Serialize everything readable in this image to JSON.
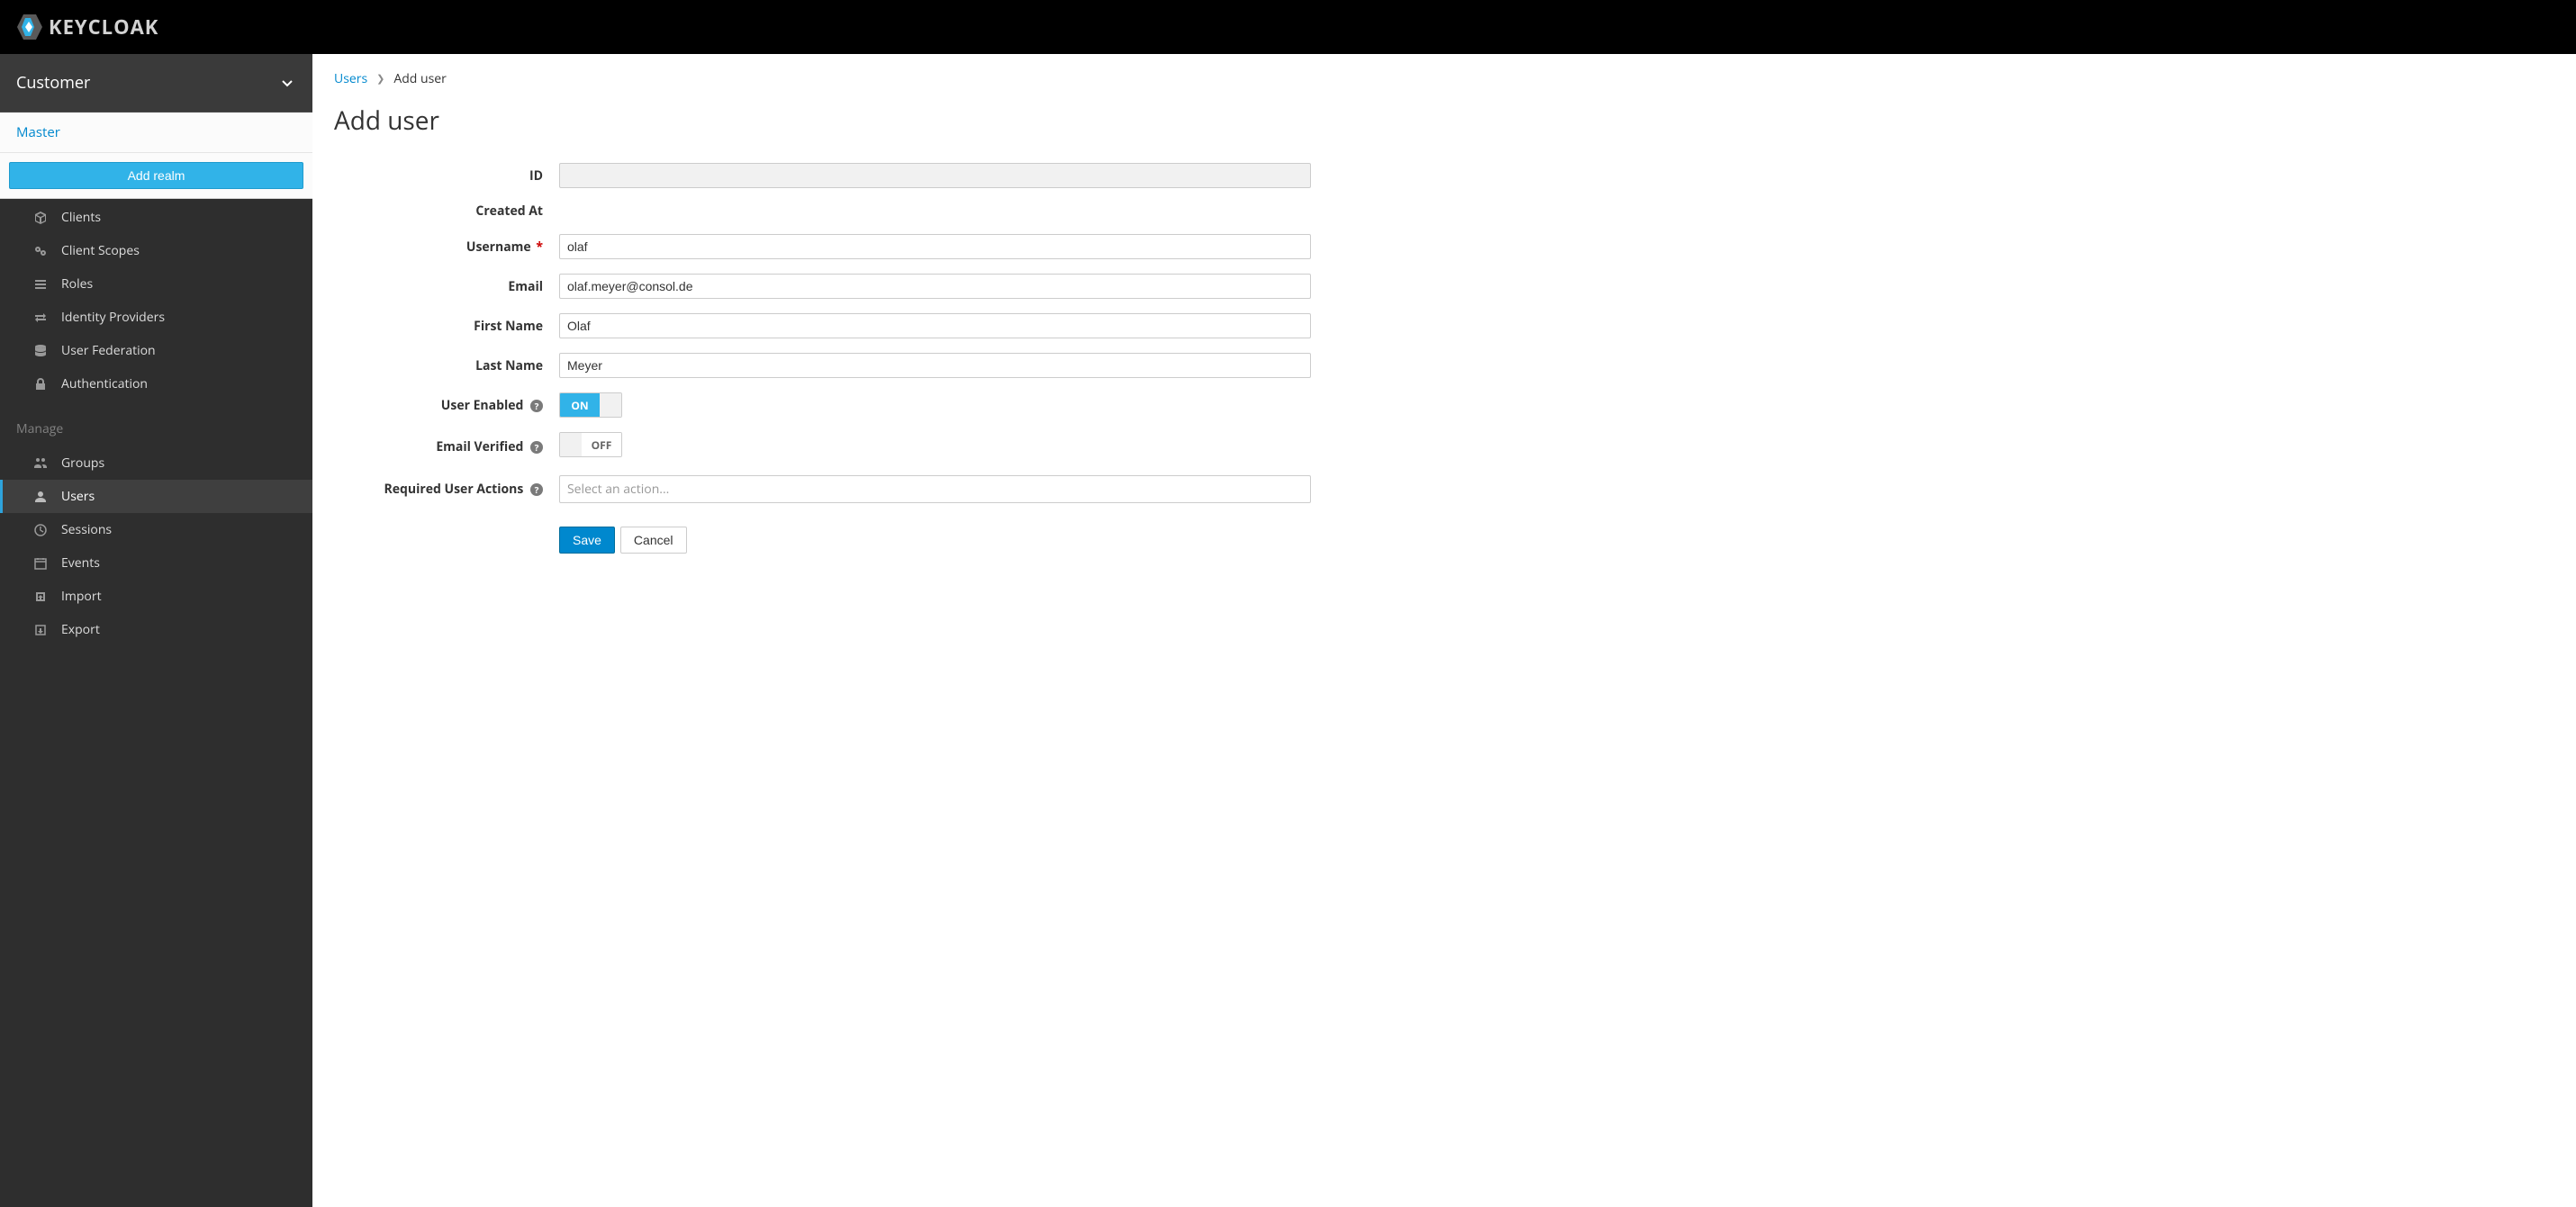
{
  "brand": "KEYCLOAK",
  "realm": {
    "current": "Customer",
    "dropdown_item": "Master",
    "add_realm_label": "Add realm"
  },
  "nav": {
    "configure": [
      {
        "label": "Clients",
        "icon": "cube-icon"
      },
      {
        "label": "Client Scopes",
        "icon": "scopes-icon"
      },
      {
        "label": "Roles",
        "icon": "list-icon"
      },
      {
        "label": "Identity Providers",
        "icon": "exchange-icon"
      },
      {
        "label": "User Federation",
        "icon": "database-icon"
      },
      {
        "label": "Authentication",
        "icon": "lock-icon"
      }
    ],
    "manage_label": "Manage",
    "manage": [
      {
        "label": "Groups",
        "icon": "group-icon",
        "active": false
      },
      {
        "label": "Users",
        "icon": "user-icon",
        "active": true
      },
      {
        "label": "Sessions",
        "icon": "clock-icon",
        "active": false
      },
      {
        "label": "Events",
        "icon": "calendar-icon",
        "active": false
      },
      {
        "label": "Import",
        "icon": "import-icon",
        "active": false
      },
      {
        "label": "Export",
        "icon": "export-icon",
        "active": false
      }
    ]
  },
  "breadcrumb": {
    "parent": "Users",
    "current": "Add user"
  },
  "page_title": "Add user",
  "form": {
    "id_label": "ID",
    "id_value": "",
    "created_at_label": "Created At",
    "created_at_value": "",
    "username_label": "Username",
    "username_value": "olaf",
    "email_label": "Email",
    "email_value": "olaf.meyer@consol.de",
    "first_name_label": "First Name",
    "first_name_value": "Olaf",
    "last_name_label": "Last Name",
    "last_name_value": "Meyer",
    "user_enabled_label": "User Enabled",
    "user_enabled_on": "ON",
    "email_verified_label": "Email Verified",
    "email_verified_off": "OFF",
    "required_actions_label": "Required User Actions",
    "required_actions_placeholder": "Select an action...",
    "save_label": "Save",
    "cancel_label": "Cancel"
  }
}
